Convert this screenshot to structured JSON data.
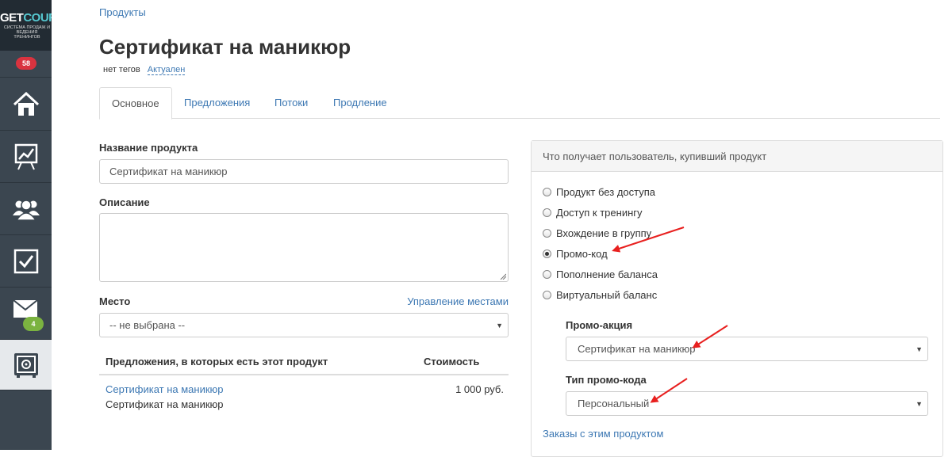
{
  "app": {
    "logo_get": "GET",
    "logo_course": "COURSE",
    "logo_tagline": "СИСТЕМА ПРОДАЖ И ВЕДЕНИЯ ТРЕНИНГОВ",
    "notifications_count": "58",
    "messages_count": "4"
  },
  "sidebar": {
    "items": [
      {
        "icon": "home-icon"
      },
      {
        "icon": "chart-board-icon"
      },
      {
        "icon": "users-icon"
      },
      {
        "icon": "tasks-checkbox-icon"
      },
      {
        "icon": "mail-icon"
      },
      {
        "icon": "safe-products-icon"
      }
    ]
  },
  "breadcrumb": "Продукты",
  "page": {
    "title": "Сертификат на маникюр",
    "tags": "нет тегов",
    "status": "Актуален"
  },
  "tabs": [
    "Основное",
    "Предложения",
    "Потоки",
    "Продление"
  ],
  "form": {
    "name_label": "Название продукта",
    "name_value": "Сертификат на маникюр",
    "description_label": "Описание",
    "description_value": "",
    "place_label": "Место",
    "manage_places_link": "Управление местами",
    "place_value": "-- не выбрана --"
  },
  "offers_table": {
    "headers": [
      "Предложения, в которых есть этот продукт",
      "Стоимость"
    ],
    "rows": [
      {
        "link": "Сертификат на маникюр",
        "subtitle": "Сертификат на маникюр",
        "price": "1 000 руб."
      }
    ]
  },
  "right_panel": {
    "heading": "Что получает пользователь, купивший продукт",
    "options": [
      {
        "label": "Продукт без доступа",
        "checked": false
      },
      {
        "label": "Доступ к тренингу",
        "checked": false
      },
      {
        "label": "Вхождение в группу",
        "checked": false
      },
      {
        "label": "Промо-код",
        "checked": true
      },
      {
        "label": "Пополнение баланса",
        "checked": false
      },
      {
        "label": "Виртуальный баланс",
        "checked": false
      }
    ],
    "promo_action_label": "Промо-акция",
    "promo_action_value": "Сертификат на маникюр",
    "promo_type_label": "Тип промо-кода",
    "promo_type_value": "Персональный",
    "orders_link": "Заказы с этим продуктом"
  },
  "colors": {
    "sidebar_bg": "#3b4650",
    "link": "#3d78b3",
    "annotation_arrow": "#e8201f",
    "badge_red": "#d9333f",
    "badge_green": "#7bb340"
  }
}
